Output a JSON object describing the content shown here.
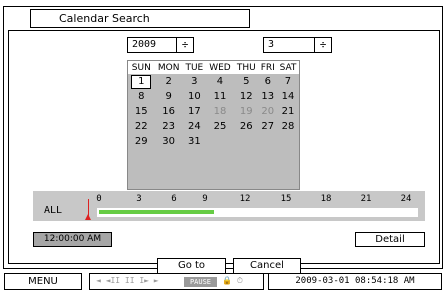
{
  "dialog": {
    "title": "Calendar Search",
    "year": "2009",
    "month": "3",
    "spin_glyph": "÷"
  },
  "calendar": {
    "weekdays": [
      "SUN",
      "MON",
      "TUE",
      "WED",
      "THU",
      "FRI",
      "SAT"
    ],
    "selected_day": "1",
    "weeks": [
      [
        "1",
        "2",
        "3",
        "4",
        "5",
        "6",
        "7"
      ],
      [
        "8",
        "9",
        "10",
        "11",
        "12",
        "13",
        "14"
      ],
      [
        "15",
        "16",
        "17",
        "18",
        "19",
        "20",
        "21"
      ],
      [
        "22",
        "23",
        "24",
        "25",
        "26",
        "27",
        "28"
      ],
      [
        "29",
        "30",
        "31",
        "",
        "",
        "",
        ""
      ]
    ]
  },
  "timeline": {
    "channel_label": "ALL",
    "hour_ticks": [
      "0",
      "3",
      "6",
      "9",
      "12",
      "15",
      "18",
      "21",
      "24"
    ],
    "recorded_range_hours": [
      0,
      9
    ]
  },
  "time_display": "12:00:00 AM",
  "buttons": {
    "detail": "Detail",
    "goto": "Go to",
    "cancel": "Cancel"
  },
  "status_bar": {
    "menu": "MENU",
    "playback_glyphs": "◄ ◄II II I► ►",
    "pause": "PAUSE",
    "extra_icons": "🔒 ⏱",
    "datetime": "2009-03-01 08:54:18 AM"
  }
}
